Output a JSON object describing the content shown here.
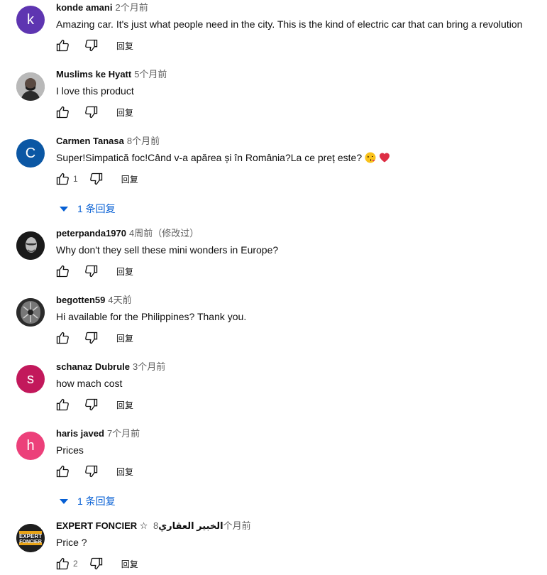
{
  "comments": [
    {
      "author": "konde amani",
      "time": "2个月前",
      "text": "Amazing car. It's just what people need in the city. This is the kind of electric car that can bring a revolution",
      "avatar_letter": "k",
      "avatar_color": "#5e35b1",
      "likes": "",
      "reply": "回复"
    },
    {
      "author": "Muslims ke Hyatt",
      "time": "5个月前",
      "text": "I love this product",
      "avatar_letter": "",
      "likes": "",
      "reply": "回复"
    },
    {
      "author": "Carmen Tanasa",
      "time": "8个月前",
      "text": "Super!Simpatică foc!Când v-a apărea și în România?La ce preț este?",
      "avatar_letter": "C",
      "avatar_color": "#0b57a4",
      "likes": "1",
      "reply": "回复",
      "replies_label": "1 条回复"
    },
    {
      "author": "peterpanda1970",
      "time": "4周前（修改过）",
      "text": "Why don't they sell these mini wonders in Europe?",
      "avatar_letter": "",
      "likes": "",
      "reply": "回复"
    },
    {
      "author": "begotten59",
      "time": "4天前",
      "text": "Hi available for the Philippines? Thank you.",
      "avatar_letter": "",
      "likes": "",
      "reply": "回复"
    },
    {
      "author": "schanaz Dubrule",
      "time": "3个月前",
      "text": "how mach cost",
      "avatar_letter": "s",
      "avatar_color": "#c2185b",
      "likes": "",
      "reply": "回复"
    },
    {
      "author": "haris javed",
      "time": "7个月前",
      "text": "Prices",
      "avatar_letter": "h",
      "avatar_color": "#ec407a",
      "likes": "",
      "reply": "回复",
      "replies_label": "1 条回复"
    },
    {
      "author": "EXPERT FONCIER ☆ الخبير العقاري",
      "time": "8个月前",
      "text": "Price ?",
      "avatar_letter": "",
      "avatar_text_top": "EXPERT",
      "avatar_text_bottom": "FONCIER",
      "likes": "2",
      "reply": "回复"
    }
  ]
}
